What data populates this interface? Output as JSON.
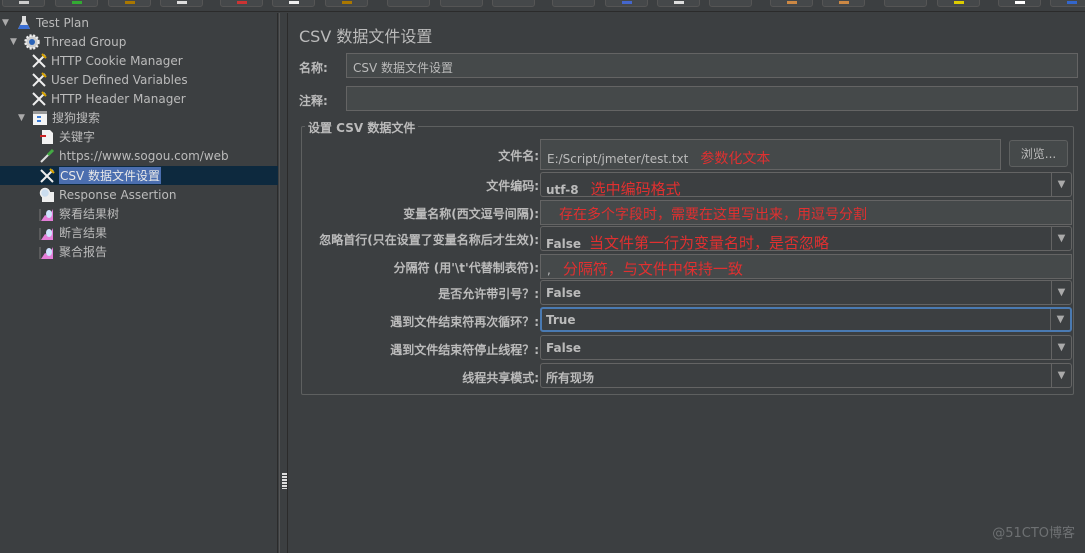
{
  "toolbar": {
    "buttons": 20
  },
  "tree": {
    "items": [
      {
        "label": "Test Plan",
        "icon": "test-plan-flask-icon",
        "expanded": true
      },
      {
        "label": "Thread Group",
        "icon": "thread-group-gear-icon",
        "expanded": true
      },
      {
        "label": "HTTP Cookie Manager",
        "icon": "config-wrench-icon"
      },
      {
        "label": "User Defined Variables",
        "icon": "config-wrench-icon"
      },
      {
        "label": "HTTP Header Manager",
        "icon": "config-wrench-icon"
      },
      {
        "label": "搜狗搜索",
        "icon": "transaction-controller-icon",
        "expanded": true
      },
      {
        "label": "关键字",
        "icon": "module-page-icon"
      },
      {
        "label": "https://www.sogou.com/web",
        "icon": "sampler-pipette-icon"
      },
      {
        "label": "CSV 数据文件设置",
        "icon": "config-wrench-icon",
        "selected": true
      },
      {
        "label": "Response Assertion",
        "icon": "assertion-magnifier-icon"
      },
      {
        "label": "察看结果树",
        "icon": "listener-chart-icon"
      },
      {
        "label": "断言结果",
        "icon": "listener-chart-icon"
      },
      {
        "label": "聚合报告",
        "icon": "listener-chart-icon"
      }
    ]
  },
  "panel": {
    "title": "CSV 数据文件设置",
    "name_label": "名称:",
    "name_value": "CSV 数据文件设置",
    "comment_label": "注释:",
    "comment_value": "",
    "group_title": "设置 CSV 数据文件",
    "browse_label": "浏览...",
    "rows": [
      {
        "label": "文件名:",
        "value": "E:/Script/jmeter/test.txt",
        "annotation": "参数化文本",
        "type": "text"
      },
      {
        "label": "文件编码:",
        "value": "utf-8",
        "annotation": "选中编码格式",
        "type": "combo"
      },
      {
        "label": "变量名称(西文逗号间隔):",
        "value": "",
        "annotation": "存在多个字段时，需要在这里写出来，用逗号分割",
        "type": "text"
      },
      {
        "label": "忽略首行(只在设置了变量名称后才生效):",
        "value": "False",
        "annotation": "当文件第一行为变量名时，是否忽略",
        "type": "combo"
      },
      {
        "label": "分隔符 (用'\\t'代替制表符):",
        "value": ",",
        "annotation": "分隔符，与文件中保持一致",
        "type": "text"
      },
      {
        "label": "是否允许带引号？:",
        "value": "False",
        "annotation": "",
        "type": "combo"
      },
      {
        "label": "遇到文件结束符再次循环？:",
        "value": "True",
        "annotation": "",
        "type": "combo",
        "focused": true
      },
      {
        "label": "遇到文件结束符停止线程？:",
        "value": "False",
        "annotation": "",
        "type": "combo"
      },
      {
        "label": "线程共享模式:",
        "value": "所有现场",
        "annotation": "",
        "type": "combo"
      }
    ]
  },
  "watermark": "@51CTO博客",
  "colors": {
    "background": "#3c3f41",
    "selection": "#4b6eaf",
    "annotation": "#e03030",
    "focus": "#4a7ab2"
  }
}
